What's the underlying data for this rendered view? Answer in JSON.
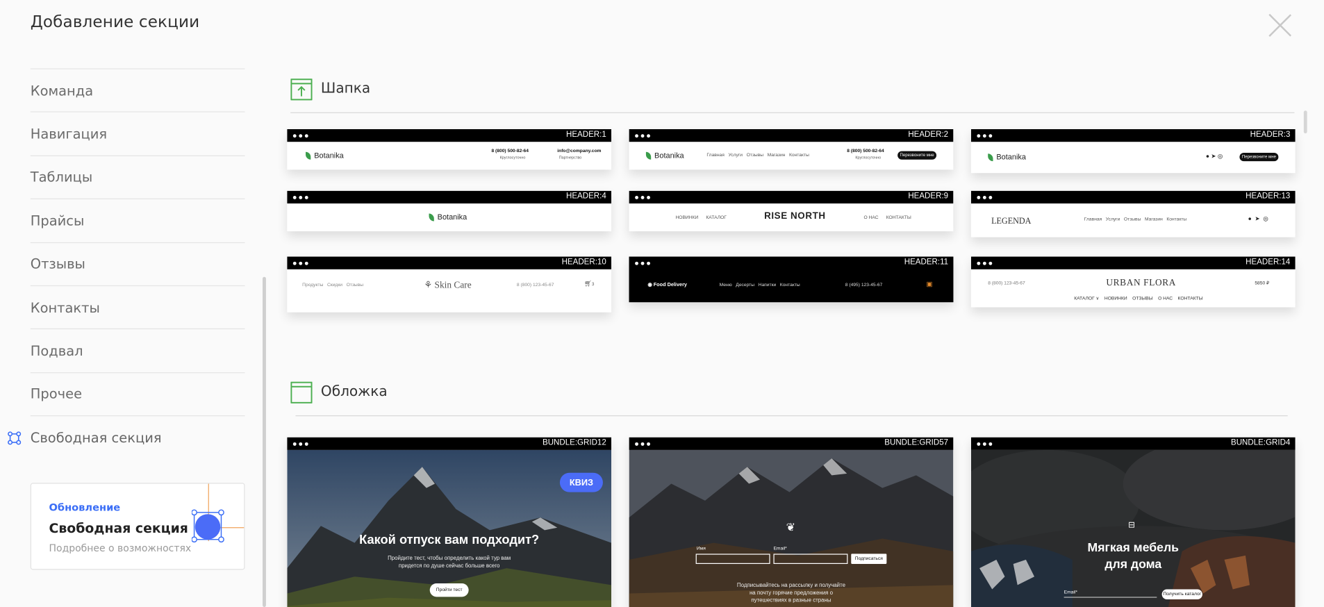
{
  "modal": {
    "title": "Добавление секции"
  },
  "sidebar": {
    "items": [
      {
        "label": "Команда"
      },
      {
        "label": "Навигация"
      },
      {
        "label": "Таблицы"
      },
      {
        "label": "Прайсы"
      },
      {
        "label": "Отзывы"
      },
      {
        "label": "Контакты"
      },
      {
        "label": "Подвал"
      },
      {
        "label": "Прочее"
      }
    ],
    "free_label": "Свободная секция"
  },
  "update": {
    "tag": "Обновление",
    "title": "Свободная секция",
    "subtitle": "Подробнее о возможностях"
  },
  "sections": [
    {
      "title": "Шапка",
      "icon": "header-upload-icon"
    },
    {
      "title": "Обложка",
      "icon": "cover-window-icon"
    }
  ],
  "headers": [
    {
      "code": "HEADER:1",
      "brand": "Botanika",
      "phone": "8 (800) 500-82-64",
      "phone_note": "Круглосуточно",
      "email": "info@company.com",
      "email_note": "Партнерство"
    },
    {
      "code": "HEADER:2",
      "brand": "Botanika",
      "nav": "Главная   Услуги   Отзывы   Магазин   Контакты",
      "phone": "8 (800) 500-82-64",
      "phone_note": "Круглосуточно",
      "button": "Перезвоните мне"
    },
    {
      "code": "HEADER:3",
      "brand": "Botanika",
      "button": "Перезвоните мне"
    },
    {
      "code": "HEADER:4",
      "brand": "Botanika"
    },
    {
      "code": "HEADER:9",
      "brand": "RISE NORTH",
      "left": "НОВИНКИ      КАТАЛОГ",
      "right": "О НАС      КОНТАКТЫ"
    },
    {
      "code": "HEADER:13",
      "brand": "LEGENDA",
      "nav": "Главная   Услуги   Отзывы   Магазин   Контакты"
    },
    {
      "code": "HEADER:10",
      "brand": "Skin Care",
      "nav": "Продукты   Скидки   Отзывы",
      "phone": "8 (800) 123-45-67",
      "cart": "3"
    },
    {
      "code": "HEADER:11",
      "brand": "Food Delivery",
      "nav": "Меню   Десерты   Напитки   Контакты",
      "phone": "8 (495) 123-45-67"
    },
    {
      "code": "HEADER:14",
      "brand": "URBAN FLORA",
      "phone": "8 (800) 123-45-67",
      "price": "5850 ₽",
      "nav": "КАТАЛОГ ∨    НОВИНКИ    ОТЗЫВЫ    О НАС    КОНТАКТЫ"
    }
  ],
  "covers": [
    {
      "code": "BUNDLE:GRID12",
      "badge": "КВИЗ",
      "title": "Какой отпуск вам подходит?",
      "subtitle": "Пройдите тест, чтобы определить какой тур вам\nпридется по душе сейчас больше всего",
      "button": "Пройти тест"
    },
    {
      "code": "BUNDLE:GRID57",
      "name_label": "Имя",
      "email_label": "Email*",
      "button": "Подписаться",
      "subtitle": "Подписывайтесь на рассылку и получайте\nна почту горячие предложения о\nпутешествиях в разные страны"
    },
    {
      "code": "BUNDLE:GRID4",
      "title": "Мягкая мебель\nдля дома",
      "email_label": "Email*",
      "button": "Получить каталог"
    }
  ]
}
